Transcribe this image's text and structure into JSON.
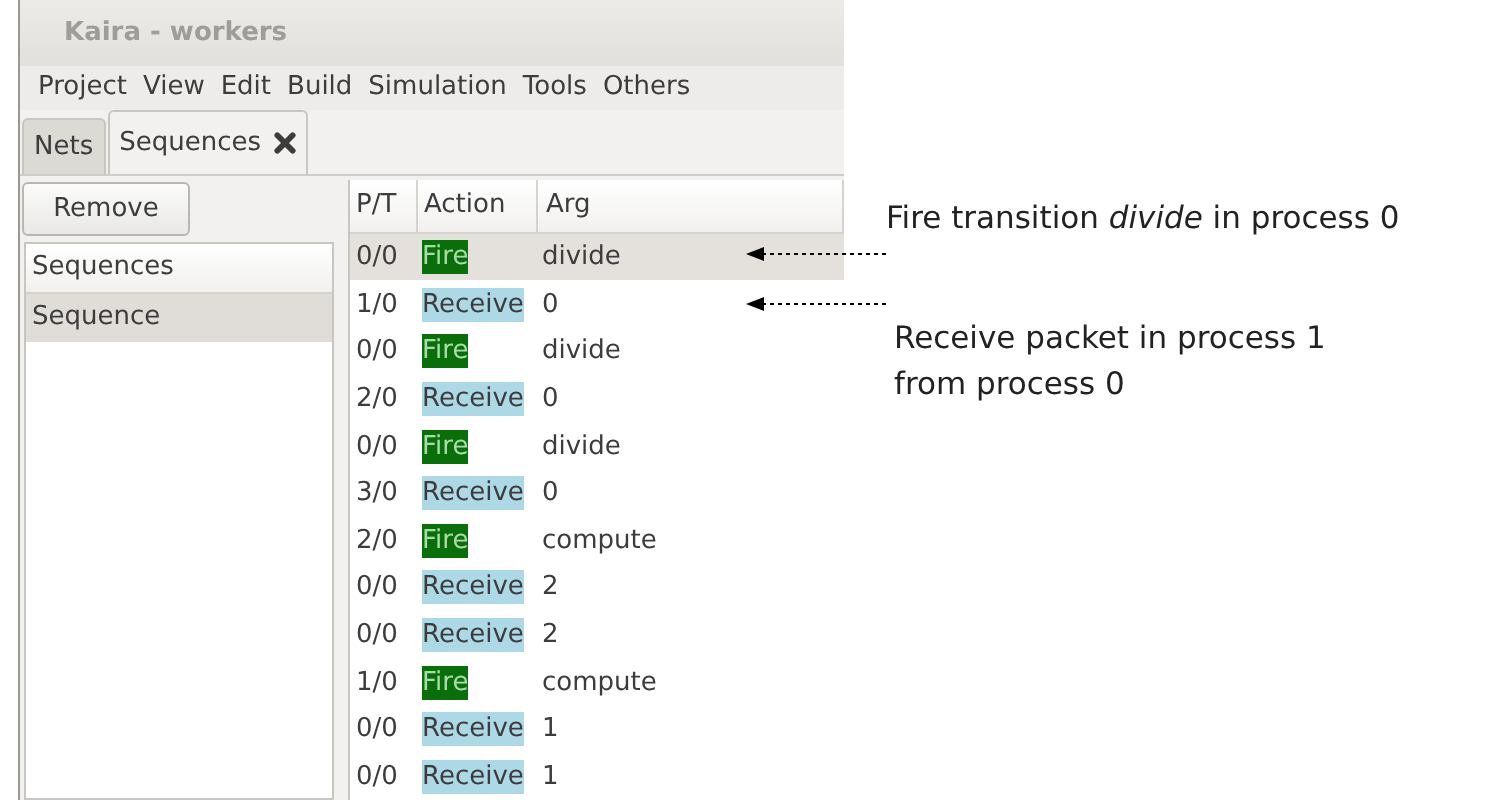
{
  "window": {
    "title": "Kaira - workers"
  },
  "menu": [
    "Project",
    "View",
    "Edit",
    "Build",
    "Simulation",
    "Tools",
    "Others"
  ],
  "tabs": [
    {
      "label": "Nets",
      "selected": false,
      "closable": false
    },
    {
      "label": "Sequences",
      "selected": true,
      "closable": true
    }
  ],
  "sidebar": {
    "button": "Remove",
    "header": "Sequences",
    "items": [
      {
        "label": "Sequence",
        "selected": true
      }
    ]
  },
  "table": {
    "columns": [
      "P/T",
      "Action",
      "Arg"
    ],
    "rows": [
      {
        "pt": "0/0",
        "action": "Fire",
        "kind": "fire",
        "arg": "divide",
        "selected": true
      },
      {
        "pt": "1/0",
        "action": "Receive",
        "kind": "receive",
        "arg": "0",
        "selected": false
      },
      {
        "pt": "0/0",
        "action": "Fire",
        "kind": "fire",
        "arg": "divide",
        "selected": false
      },
      {
        "pt": "2/0",
        "action": "Receive",
        "kind": "receive",
        "arg": "0",
        "selected": false
      },
      {
        "pt": "0/0",
        "action": "Fire",
        "kind": "fire",
        "arg": "divide",
        "selected": false
      },
      {
        "pt": "3/0",
        "action": "Receive",
        "kind": "receive",
        "arg": "0",
        "selected": false
      },
      {
        "pt": "2/0",
        "action": "Fire",
        "kind": "fire",
        "arg": "compute",
        "selected": false
      },
      {
        "pt": "0/0",
        "action": "Receive",
        "kind": "receive",
        "arg": "2",
        "selected": false
      },
      {
        "pt": "0/0",
        "action": "Receive",
        "kind": "receive",
        "arg": "2",
        "selected": false
      },
      {
        "pt": "1/0",
        "action": "Fire",
        "kind": "fire",
        "arg": "compute",
        "selected": false
      },
      {
        "pt": "0/0",
        "action": "Receive",
        "kind": "receive",
        "arg": "1",
        "selected": false
      },
      {
        "pt": "0/0",
        "action": "Receive",
        "kind": "receive",
        "arg": "1",
        "selected": false
      }
    ]
  },
  "annotations": [
    {
      "text": "Fire transition *divide* in process 0"
    },
    {
      "text": "Receive packet in process 1\nfrom process 0"
    }
  ]
}
